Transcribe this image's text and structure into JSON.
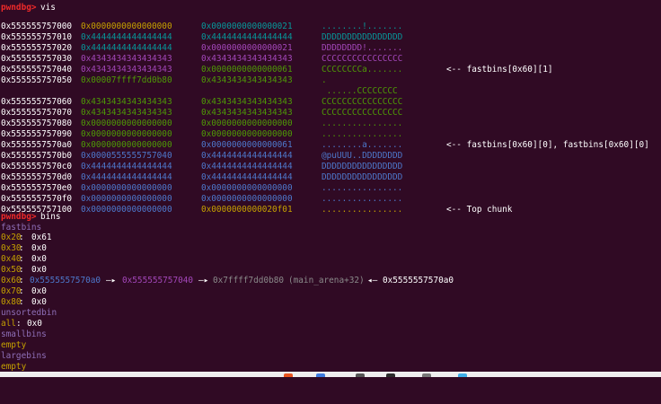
{
  "prompt": "pwndbg>",
  "vis": {
    "command": "vis",
    "rows": [
      {
        "addr": "0x555555757000",
        "q1": "0x0000000000000000",
        "q2": "0x0000000000000021",
        "ascii": "........!.......",
        "c1": "y",
        "c2": "cyan",
        "ca": "cyan",
        "note": ""
      },
      {
        "addr": "0x555555757010",
        "q1": "0x4444444444444444",
        "q2": "0x4444444444444444",
        "ascii": "DDDDDDDDDDDDDDDD",
        "c1": "cyan",
        "c2": "cyan",
        "ca": "cyan",
        "note": ""
      },
      {
        "addr": "0x555555757020",
        "q1": "0x4444444444444444",
        "q2": "0x0000000000000021",
        "ascii": "DDDDDDDD!.......",
        "c1": "cyan",
        "c2": "magenta",
        "ca": "magenta",
        "note": ""
      },
      {
        "addr": "0x555555757030",
        "q1": "0x4343434343434343",
        "q2": "0x4343434343434343",
        "ascii": "CCCCCCCCCCCCCCCC",
        "c1": "magenta",
        "c2": "magenta",
        "ca": "magenta",
        "note": ""
      },
      {
        "addr": "0x555555757040",
        "q1": "0x4343434343434343",
        "q2": "0x0000000000000061",
        "ascii": "CCCCCCCCa.......",
        "c1": "magenta",
        "c2": "g",
        "ca": "g",
        "note": "<-- fastbins[0x60][1]"
      },
      {
        "addr": "0x555555757050",
        "q1": "0x00007ffff7dd0b80",
        "q2": "0x4343434343434343",
        "ascii": ".",
        "c1": "g",
        "c2": "g",
        "ca": "g",
        "note": ""
      },
      {
        "addr": "",
        "q1": "",
        "q2": "",
        "ascii": " ......CCCCCCCC",
        "c1": "g",
        "c2": "g",
        "ca": "g",
        "note": ""
      },
      {
        "addr": "0x555555757060",
        "q1": "0x4343434343434343",
        "q2": "0x4343434343434343",
        "ascii": "CCCCCCCCCCCCCCCC",
        "c1": "g",
        "c2": "g",
        "ca": "g",
        "note": ""
      },
      {
        "addr": "0x555555757070",
        "q1": "0x4343434343434343",
        "q2": "0x4343434343434343",
        "ascii": "CCCCCCCCCCCCCCCC",
        "c1": "g",
        "c2": "g",
        "ca": "g",
        "note": ""
      },
      {
        "addr": "0x555555757080",
        "q1": "0x0000000000000000",
        "q2": "0x0000000000000000",
        "ascii": "................",
        "c1": "g",
        "c2": "g",
        "ca": "g",
        "note": ""
      },
      {
        "addr": "0x555555757090",
        "q1": "0x0000000000000000",
        "q2": "0x0000000000000000",
        "ascii": "................",
        "c1": "g",
        "c2": "g",
        "ca": "g",
        "note": ""
      },
      {
        "addr": "0x5555557570a0",
        "q1": "0x0000000000000000",
        "q2": "0x0000000000000061",
        "ascii": "........a.......",
        "c1": "g",
        "c2": "blue",
        "ca": "blue",
        "note": "<-- fastbins[0x60][0], fastbins[0x60][0]"
      },
      {
        "addr": "0x5555557570b0",
        "q1": "0x0000555555757040",
        "q2": "0x4444444444444444",
        "ascii": "@puUUU..DDDDDDDD",
        "c1": "blue",
        "c2": "blue",
        "ca": "blue",
        "note": ""
      },
      {
        "addr": "0x5555557570c0",
        "q1": "0x4444444444444444",
        "q2": "0x4444444444444444",
        "ascii": "DDDDDDDDDDDDDDDD",
        "c1": "blue",
        "c2": "blue",
        "ca": "blue",
        "note": ""
      },
      {
        "addr": "0x5555557570d0",
        "q1": "0x4444444444444444",
        "q2": "0x4444444444444444",
        "ascii": "DDDDDDDDDDDDDDDD",
        "c1": "blue",
        "c2": "blue",
        "ca": "blue",
        "note": ""
      },
      {
        "addr": "0x5555557570e0",
        "q1": "0x0000000000000000",
        "q2": "0x0000000000000000",
        "ascii": "................",
        "c1": "blue",
        "c2": "blue",
        "ca": "blue",
        "note": ""
      },
      {
        "addr": "0x5555557570f0",
        "q1": "0x0000000000000000",
        "q2": "0x0000000000000000",
        "ascii": "................",
        "c1": "blue",
        "c2": "blue",
        "ca": "blue",
        "note": ""
      },
      {
        "addr": "0x555555757100",
        "q1": "0x0000000000000000",
        "q2": "0x0000000000020f01",
        "ascii": "................",
        "c1": "blue",
        "c2": "y",
        "ca": "y",
        "note": "<-- Top chunk"
      }
    ]
  },
  "bins": {
    "command": "bins",
    "fastbins_label": "fastbins",
    "fastbins": [
      {
        "size": "0x20",
        "value": "0x61"
      },
      {
        "size": "0x30",
        "value": "0x0"
      },
      {
        "size": "0x40",
        "value": "0x0"
      },
      {
        "size": "0x50",
        "value": "0x0"
      }
    ],
    "chain": {
      "size": "0x60",
      "first": "0x5555557570a0",
      "arrow1": "—▸",
      "second": "0x555555757040",
      "arrow2": "—▸",
      "third": "0x7ffff7dd0b80",
      "third_sym": "(main_arena+32)",
      "back_arrow": "◂—",
      "back_addr": "0x5555557570a0"
    },
    "fastbins_tail": [
      {
        "size": "0x70",
        "value": "0x0"
      },
      {
        "size": "0x80",
        "value": "0x0"
      }
    ],
    "unsortedbin_label": "unsortedbin",
    "unsorted_all": {
      "label": "all",
      "value": "0x0"
    },
    "smallbins_label": "smallbins",
    "smallbins_value": "empty",
    "largebins_label": "largebins",
    "largebins_value": "empty"
  },
  "colors": {
    "background": "#300a24",
    "prompt": "#ef2929",
    "address": "#ffffff",
    "yellow": "#c4a000",
    "cyan": "#06989a",
    "magenta": "#a347ba",
    "green": "#4e9a06",
    "blue": "#4d78cc",
    "heading": "#8e6fb8",
    "muted": "#a5a0a3"
  }
}
